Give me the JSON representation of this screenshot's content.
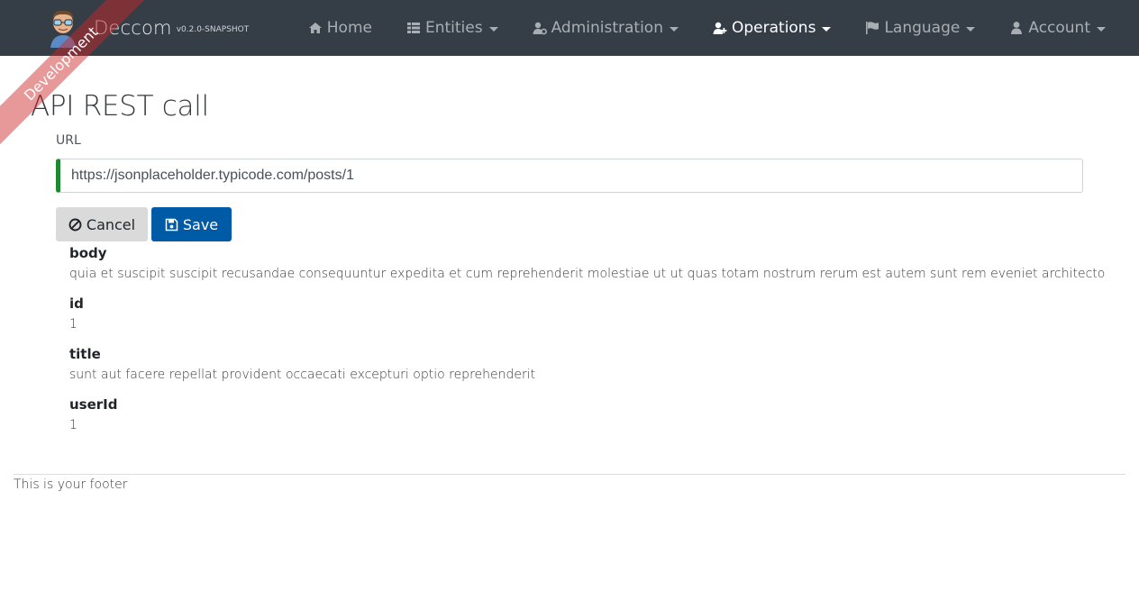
{
  "app": {
    "brand": "Deccom",
    "version": "v0.2.0-SNAPSHOT",
    "ribbon": "Development"
  },
  "nav": {
    "items": [
      {
        "label": "Home",
        "icon": "home-icon"
      },
      {
        "label": "Entities",
        "icon": "th-list-icon",
        "dropdown": true
      },
      {
        "label": "Administration",
        "icon": "user-cog-icon",
        "dropdown": true
      },
      {
        "label": "Operations",
        "icon": "user-plus-icon",
        "dropdown": true,
        "active": true
      },
      {
        "label": "Language",
        "icon": "flag-icon",
        "dropdown": true
      },
      {
        "label": "Account",
        "icon": "user-icon",
        "dropdown": true
      }
    ]
  },
  "page": {
    "title": "API REST call",
    "url_label": "URL",
    "url_value": "https://jsonplaceholder.typicode.com/posts/1"
  },
  "buttons": {
    "cancel": "Cancel",
    "save": "Save"
  },
  "fields": [
    {
      "name": "body",
      "value": "quia et suscipit suscipit recusandae consequuntur expedita et cum reprehenderit molestiae ut ut quas totam nostrum rerum est autem sunt rem eveniet architecto"
    },
    {
      "name": "id",
      "value": "1"
    },
    {
      "name": "title",
      "value": "sunt aut facere repellat provident occaecati excepturi optio reprehenderit"
    },
    {
      "name": "userId",
      "value": "1"
    }
  ],
  "footer": {
    "text": "This is your footer"
  },
  "colors": {
    "navbar": "#353d47",
    "nav_text": "#a9aeb3",
    "nav_active": "#ffffff",
    "ribbon": "#cc2828",
    "save_button": "#005ba6",
    "cancel_button": "#dadada",
    "input_valid_border": "#1e8a2f"
  }
}
